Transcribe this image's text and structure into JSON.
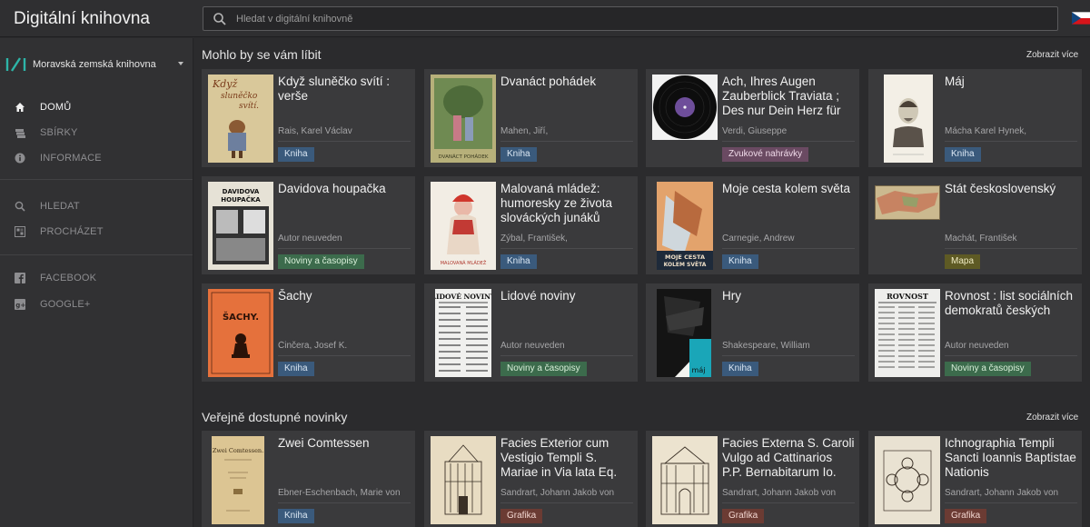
{
  "app": {
    "title": "Digitální knihovna"
  },
  "search": {
    "placeholder": "Hledat v digitální knihovně"
  },
  "library": {
    "name": "Moravská zemská knihovna"
  },
  "nav": {
    "home": "DOMŮ",
    "collections": "SBÍRKY",
    "info": "INFORMACE",
    "search": "HLEDAT",
    "browse": "PROCHÁZET",
    "facebook": "FACEBOOK",
    "google": "GOOGLE+"
  },
  "section1": {
    "title": "Mohlo by se vám líbit",
    "more": "Zobrazit více",
    "cards": [
      {
        "title": "Když sluněčko svítí : verše",
        "author": "Rais, Karel Václav",
        "badge": "Kniha",
        "type": "kniha"
      },
      {
        "title": "Dvanáct pohádek",
        "author": "Mahen, Jiří,",
        "badge": "Kniha",
        "type": "kniha"
      },
      {
        "title": "Ach, Ihres Augen Zauberblick Traviata ; Des nur Dein Herz für",
        "author": "Verdi, Giuseppe",
        "badge": "Zvukové nahrávky",
        "type": "zvuk"
      },
      {
        "title": "Máj",
        "author": "Mácha Karel Hynek,",
        "badge": "Kniha",
        "type": "kniha"
      },
      {
        "title": "Davidova houpačka",
        "author": "Autor neuveden",
        "badge": "Noviny a časopisy",
        "type": "noviny"
      },
      {
        "title": "Malovaná mládež: humoresky ze života slováckých junáků",
        "author": "Zýbal, František,",
        "badge": "Kniha",
        "type": "kniha"
      },
      {
        "title": "Moje cesta kolem světa",
        "author": "Carnegie, Andrew",
        "badge": "Kniha",
        "type": "kniha"
      },
      {
        "title": "Stát československý",
        "author": "Machát, František",
        "badge": "Mapa",
        "type": "mapa"
      },
      {
        "title": "Šachy",
        "author": "Činčera, Josef K.",
        "badge": "Kniha",
        "type": "kniha"
      },
      {
        "title": "Lidové noviny",
        "author": "Autor neuveden",
        "badge": "Noviny a časopisy",
        "type": "noviny"
      },
      {
        "title": "Hry",
        "author": "Shakespeare, William",
        "badge": "Kniha",
        "type": "kniha"
      },
      {
        "title": "Rovnost : list sociálních demokratů českých",
        "author": "Autor neuveden",
        "badge": "Noviny a časopisy",
        "type": "noviny"
      }
    ]
  },
  "section2": {
    "title": "Veřejně dostupné novinky",
    "more": "Zobrazit více",
    "cards": [
      {
        "title": "Zwei Comtessen",
        "author": "Ebner-Eschenbach, Marie von",
        "badge": "Kniha",
        "type": "kniha"
      },
      {
        "title": "Facies Exterior cum Vestigio Templi S. Mariae in Via lata Eq.",
        "author": "Sandrart, Johann Jakob von",
        "badge": "Grafika",
        "type": "grafika"
      },
      {
        "title": "Facies Externa S. Caroli Vulgo ad Cattinarios P.P. Bernabitarum Io.",
        "author": "Sandrart, Johann Jakob von",
        "badge": "Grafika",
        "type": "grafika"
      },
      {
        "title": "Ichnographia Templi Sancti Ioannis Baptistae Nationis",
        "author": "Sandrart, Johann Jakob von",
        "badge": "Grafika",
        "type": "grafika"
      }
    ]
  },
  "thumb_text": {
    "s1_0": [
      "Když",
      "sluněčko",
      "svítí."
    ],
    "s1_1": [
      "DVANÁCT POHÁDEK"
    ],
    "s1_4": [
      "DAVIDOVA",
      "HOUPAČKA"
    ],
    "s1_5": [
      "MALOVANÁ MLÁDEŽ"
    ],
    "s1_6": [
      "MOJE CESTA",
      "KOLEM SVĚTA"
    ],
    "s1_8": [
      "ŠACHY."
    ],
    "s1_9": [
      "LIDOVÉ NOVINY"
    ],
    "s1_10": [
      "máj"
    ],
    "s1_11": [
      "ROVNOST"
    ],
    "s2_0": [
      "Zwei Comtessen."
    ]
  },
  "colors": {
    "kniha": "#3a5a7c",
    "noviny": "#3c6b4c",
    "zvuk": "#6a4a62",
    "mapa": "#5e5a24",
    "grafika": "#6b3b33"
  }
}
